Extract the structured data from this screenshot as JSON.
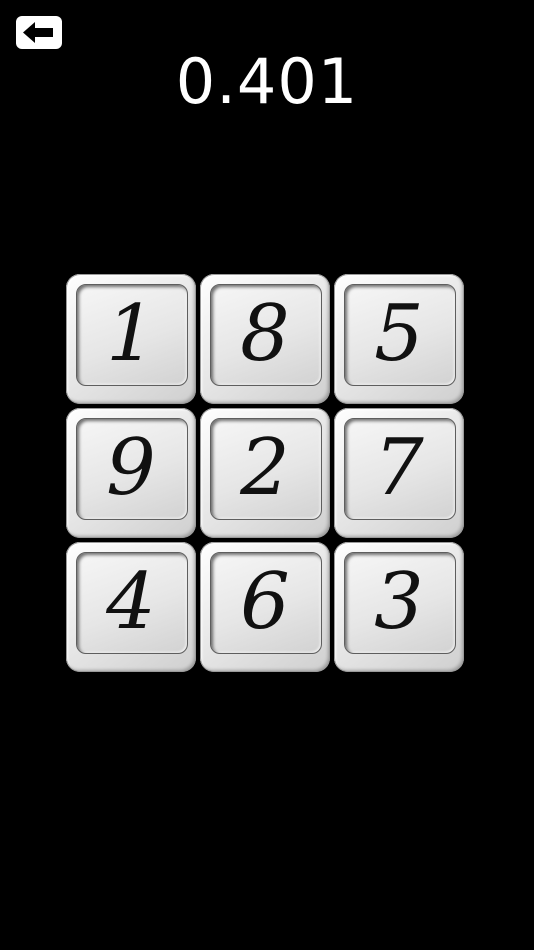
{
  "header": {
    "back_icon": "arrow-left-icon",
    "timer": "0.401"
  },
  "colors": {
    "background": "#000000",
    "tile": "#e6e6e6",
    "text": "#ffffff",
    "digit": "#111111"
  },
  "board": {
    "tiles": [
      "1",
      "8",
      "5",
      "9",
      "2",
      "7",
      "4",
      "6",
      "3"
    ]
  }
}
